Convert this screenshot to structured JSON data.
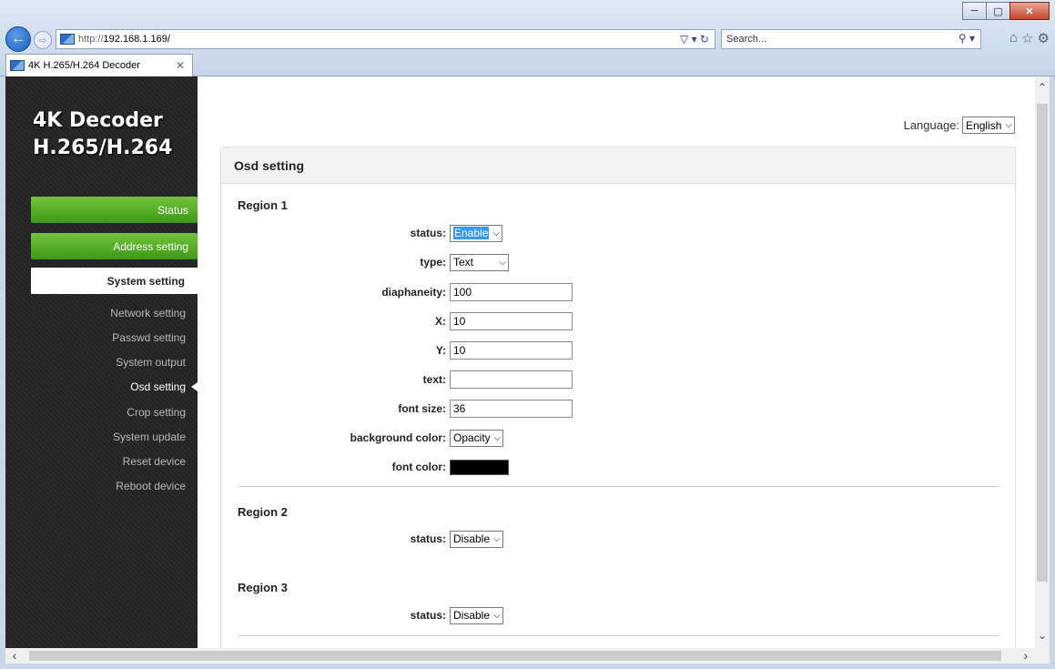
{
  "browser": {
    "url_prefix": "http://",
    "url_host": "192.168.1.169/",
    "search_placeholder": "Search...",
    "tab_title": "4K H.265/H.264 Decoder"
  },
  "sidebar": {
    "brand_line1": "4K Decoder",
    "brand_line2": "H.265/H.264",
    "main_items": [
      "Status",
      "Address setting"
    ],
    "active_item": "System setting",
    "sub_items": [
      "Network setting",
      "Passwd setting",
      "System output",
      "Osd setting",
      "Crop setting",
      "System update",
      "Reset device",
      "Reboot device"
    ],
    "current_sub_index": 3
  },
  "language": {
    "label": "Language:",
    "value": "English"
  },
  "panel": {
    "title": "Osd setting"
  },
  "region1": {
    "title": "Region 1",
    "status_label": "status:",
    "status_value": "Enable",
    "type_label": "type:",
    "type_value": "Text",
    "diaphaneity_label": "diaphaneity:",
    "diaphaneity_value": "100",
    "x_label": "X:",
    "x_value": "10",
    "y_label": "Y:",
    "y_value": "10",
    "text_label": "text:",
    "text_value": "",
    "font_size_label": "font size:",
    "font_size_value": "36",
    "bg_color_label": "background color:",
    "bg_color_value": "Opacity",
    "font_color_label": "font color:",
    "font_color_hex": "#000000"
  },
  "region2": {
    "title": "Region 2",
    "status_label": "status:",
    "status_value": "Disable"
  },
  "region3": {
    "title": "Region 3",
    "status_label": "status:",
    "status_value": "Disable"
  },
  "colors": {
    "menu_green": "#4fae22",
    "sidebar_dark": "#262626",
    "selection_blue": "#3399ff"
  }
}
